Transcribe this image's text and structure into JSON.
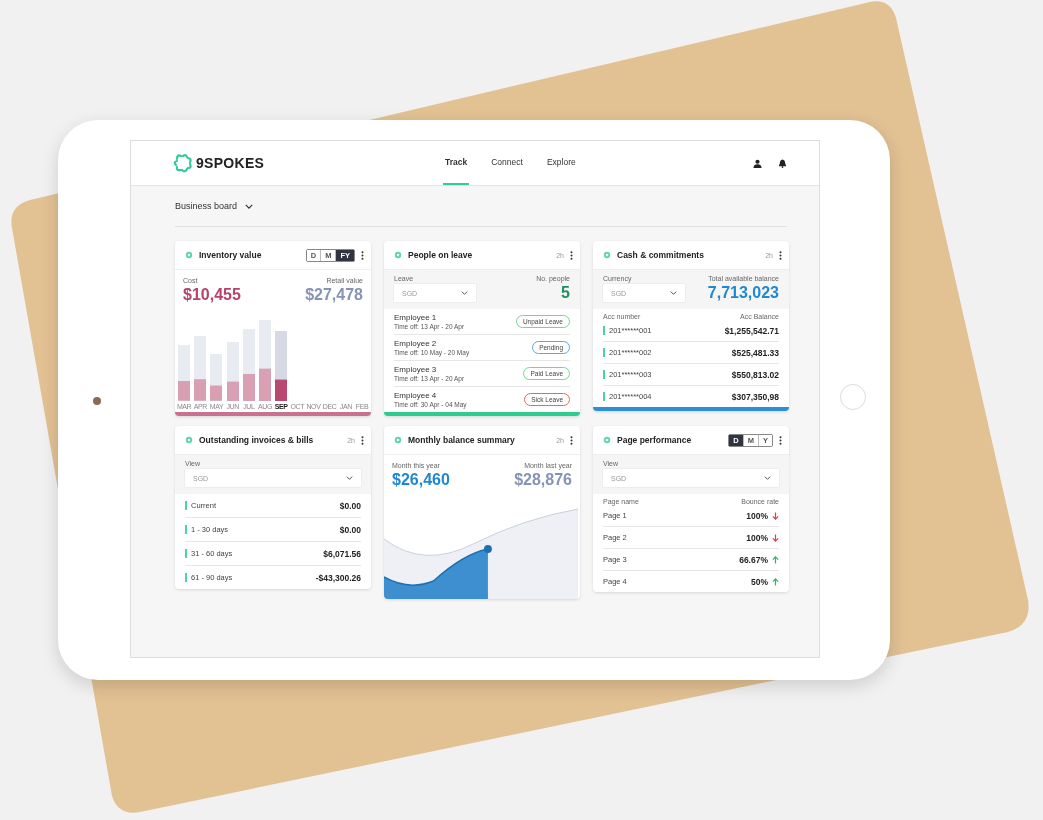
{
  "header": {
    "logo": "9SPOKES",
    "nav": [
      {
        "label": "Track",
        "selected": true
      },
      {
        "label": "Connect",
        "selected": false
      },
      {
        "label": "Explore",
        "selected": false
      }
    ]
  },
  "board_selector": {
    "label": "Business board"
  },
  "inventory_value": {
    "title": "Inventory value",
    "periods": [
      {
        "label": "D",
        "selected": false
      },
      {
        "label": "M",
        "selected": false
      },
      {
        "label": "FY",
        "selected": true
      }
    ],
    "cost_label": "Cost",
    "cost": "$10,455",
    "retail_label": "Retail value",
    "retail": "$27,478",
    "months": [
      {
        "label": "MAR",
        "selected": false
      },
      {
        "label": "APR",
        "selected": false
      },
      {
        "label": "MAY",
        "selected": false
      },
      {
        "label": "JUN",
        "selected": false
      },
      {
        "label": "JUL",
        "selected": false
      },
      {
        "label": "AUG",
        "selected": false
      },
      {
        "label": "SEP",
        "selected": true
      },
      {
        "label": "OCT",
        "selected": false
      },
      {
        "label": "NOV",
        "selected": false
      },
      {
        "label": "DEC",
        "selected": false
      },
      {
        "label": "JAN",
        "selected": false
      },
      {
        "label": "FEB",
        "selected": false
      }
    ]
  },
  "people_on_leave": {
    "title": "People on leave",
    "age": "2h",
    "leave_label": "Leave",
    "leave_value": "SGD",
    "count_label": "No. people",
    "count": "5",
    "employees": [
      {
        "name": "Employee 1",
        "time_off": "Time off: 13 Apr - 20 Apr",
        "status": "Unpaid Leave",
        "color": "#7fcf9a"
      },
      {
        "name": "Employee 2",
        "time_off": "Time off: 10 May - 20 May",
        "status": "Pending",
        "color": "#5aa7e0"
      },
      {
        "name": "Employee 3",
        "time_off": "Time off: 13 Apr - 20 Apr",
        "status": "Paid Leave",
        "color": "#7fcf9a"
      },
      {
        "name": "Employee 4",
        "time_off": "Time off: 30 Apr - 04 May",
        "status": "Sick Leave",
        "color": "#e06a6a"
      }
    ]
  },
  "cash_commitments": {
    "title": "Cash & commitments",
    "age": "2h",
    "currency_label": "Currency",
    "currency": "SGD",
    "total_label": "Total available balance",
    "total": "7,713,023",
    "columns": [
      "Acc number",
      "Acc Balance"
    ],
    "accounts": [
      {
        "number": "201******001",
        "balance": "$1,255,542.71"
      },
      {
        "number": "201******002",
        "balance": "$525,481.33"
      },
      {
        "number": "201******003",
        "balance": "$550,813.02"
      },
      {
        "number": "201******004",
        "balance": "$307,350,98"
      }
    ]
  },
  "outstanding_invoices": {
    "title": "Outstanding invoices & bills",
    "age": "2h",
    "view_label": "View",
    "view": "SGD",
    "rows": [
      {
        "label": "Current",
        "amount": "$0.00"
      },
      {
        "label": "1 - 30 days",
        "amount": "$0.00"
      },
      {
        "label": "31 - 60 days",
        "amount": "$6,071.56"
      },
      {
        "label": "61 - 90 days",
        "amount": "-$43,300.26"
      }
    ]
  },
  "monthly_balance": {
    "title": "Monthly balance summary",
    "age": "2h",
    "this_label": "Month this year",
    "this_value": "$26,460",
    "last_label": "Month last year",
    "last_value": "$28,876"
  },
  "page_performance": {
    "title": "Page performance",
    "periods": [
      {
        "label": "D",
        "selected": true
      },
      {
        "label": "M",
        "selected": false
      },
      {
        "label": "Y",
        "selected": false
      }
    ],
    "view_label": "View",
    "view": "SGD",
    "columns": [
      "Page name",
      "Bounce rate"
    ],
    "pages": [
      {
        "name": "Page 1",
        "rate": "100%",
        "rising": false
      },
      {
        "name": "Page 2",
        "rate": "100%",
        "rising": false
      },
      {
        "name": "Page 3",
        "rate": "66.67%",
        "rising": true
      },
      {
        "name": "Page 4",
        "rate": "50%",
        "rising": true
      }
    ]
  }
}
